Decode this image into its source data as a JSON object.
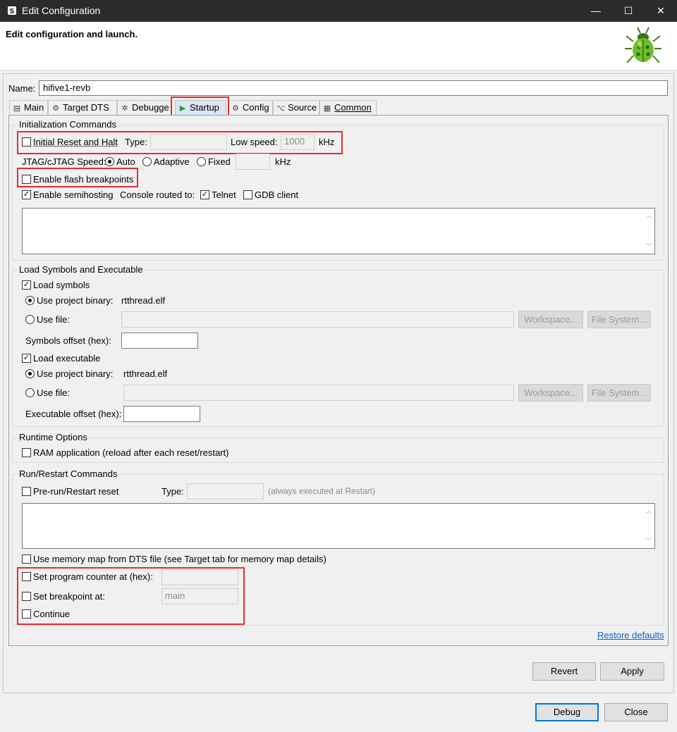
{
  "window": {
    "title": "Edit Configuration",
    "controls": [
      "—",
      "☐",
      "✕"
    ]
  },
  "header": {
    "title": "Edit configuration and launch."
  },
  "name": {
    "label": "Name:",
    "value": "hifive1-revb"
  },
  "tabs": [
    {
      "label": "Main",
      "icon": "main-tab-icon"
    },
    {
      "label": "Target DTS",
      "icon": "gear-icon"
    },
    {
      "label": "Debugge",
      "icon": "bug-icon"
    },
    {
      "label": "Startup",
      "icon": "play-icon",
      "active": true
    },
    {
      "label": "Config",
      "icon": "gear-icon"
    },
    {
      "label": "Source",
      "icon": "source-icon"
    },
    {
      "label": "Common",
      "icon": "common-icon"
    }
  ],
  "init": {
    "group_title": "Initialization Commands",
    "reset_halt_label": "Initial Reset and Halt",
    "type_label": "Type:",
    "type_value": "",
    "low_speed_label": "Low speed:",
    "low_speed_value": "1000",
    "khz_label": "kHz",
    "jtag_label": "JTAG/cJTAG Speed:",
    "auto_label": "Auto",
    "adaptive_label": "Adaptive",
    "fixed_label": "Fixed",
    "fixed_value": "",
    "khz_label2": "kHz",
    "flash_bp_label": "Enable flash breakpoints",
    "semihosting_label": "Enable semihosting",
    "console_label": "Console routed to:",
    "telnet_label": "Telnet",
    "gdb_client_label": "GDB client"
  },
  "load": {
    "group_title": "Load Symbols and Executable",
    "load_symbols_label": "Load symbols",
    "use_project_binary_label": "Use project binary:",
    "symbols_binary": "rtthread.elf",
    "use_file_label": "Use file:",
    "workspace_label": "Workspace...",
    "filesystem_label": "File System...",
    "symbols_offset_label": "Symbols offset (hex):",
    "symbols_offset_value": "",
    "load_executable_label": "Load executable",
    "use_project_binary_label2": "Use project binary:",
    "exec_binary": "rtthread.elf",
    "use_file_label2": "Use file:",
    "workspace_label2": "Workspace...",
    "filesystem_label2": "File System...",
    "exec_offset_label": "Executable offset (hex):",
    "exec_offset_value": ""
  },
  "runtime": {
    "group_title": "Runtime Options",
    "ram_app_label": "RAM application (reload after each reset/restart)"
  },
  "run": {
    "group_title": "Run/Restart Commands",
    "prerun_label": "Pre-run/Restart reset",
    "type_label": "Type:",
    "type_value": "",
    "always_label": "(always executed at Restart)",
    "memmap_label": "Use memory map from DTS file (see Target tab for memory map details)",
    "set_pc_label": "Set program counter at (hex):",
    "set_pc_value": "",
    "set_bp_label": "Set breakpoint at:",
    "set_bp_value": "main",
    "continue_label": "Continue"
  },
  "restore_defaults": "Restore defaults",
  "buttons": {
    "revert": "Revert",
    "apply": "Apply",
    "debug": "Debug",
    "close": "Close"
  },
  "colors": {
    "highlight": "#e02e35",
    "link": "#0066cc",
    "active_tab": "#dae6f3"
  }
}
